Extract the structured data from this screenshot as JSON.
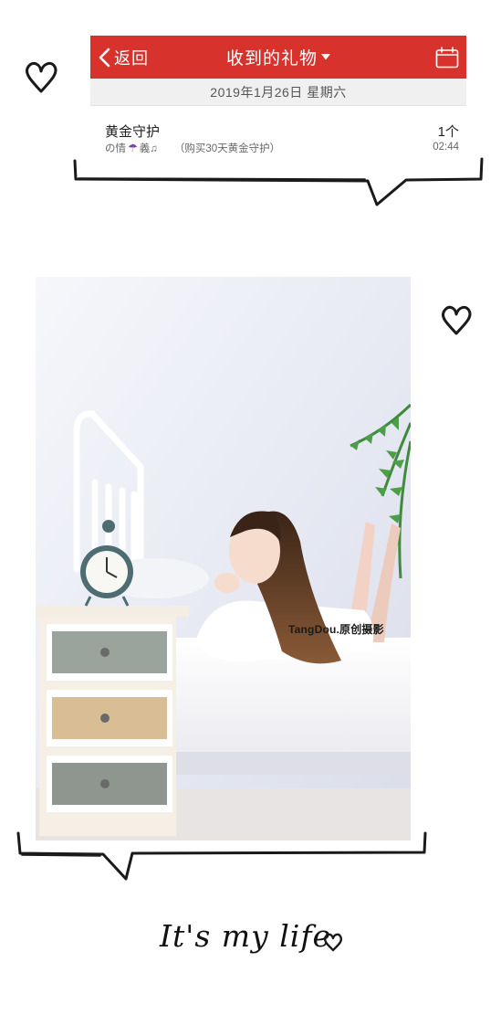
{
  "header": {
    "back_label": "返回",
    "title": "收到的礼物"
  },
  "date_bar": {
    "text": "2019年1月26日  星期六"
  },
  "gift": {
    "name": "黄金守护",
    "sender_prefix": "の情",
    "sender_symbol": "☂",
    "sender_suffix": "義♫",
    "note": "（购买30天黄金守护）",
    "count": "1个",
    "time": "02:44"
  },
  "photo": {
    "watermark": "TangDou.原创摄影"
  },
  "caption": {
    "text": "It's my life"
  },
  "colors": {
    "navbar_red": "#d8322d",
    "date_bar_gray": "#f0f0f0",
    "ink": "#111111"
  },
  "icons": [
    "chevron-left-icon",
    "caret-down-icon",
    "calendar-icon",
    "heart-doodle-icon",
    "umbrella-icon"
  ]
}
